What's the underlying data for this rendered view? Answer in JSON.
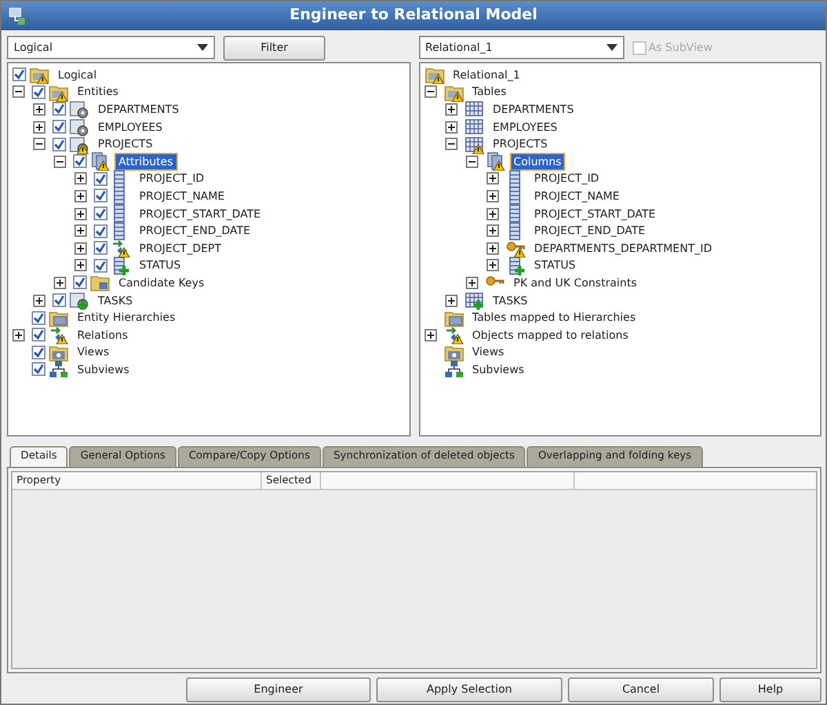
{
  "window": {
    "title": "Engineer to Relational Model"
  },
  "left_panel": {
    "combo": {
      "value": "Logical"
    },
    "filter_button": {
      "label": "Filter"
    },
    "tree": [
      {
        "label": "Logical",
        "kind": "folder",
        "warning": true,
        "checked": true,
        "selected": false,
        "children": [
          {
            "label": "Entities",
            "kind": "folder",
            "warning": true,
            "checked": true,
            "selected": false,
            "expanded": true,
            "children": [
              {
                "label": "DEPARTMENTS",
                "kind": "entity",
                "checked": true,
                "selected": false,
                "expanded": false
              },
              {
                "label": "EMPLOYEES",
                "kind": "entity",
                "checked": true,
                "selected": false,
                "expanded": false
              },
              {
                "label": "PROJECTS",
                "kind": "entity",
                "warning": true,
                "checked": true,
                "selected": false,
                "expanded": true,
                "children": [
                  {
                    "label": "Attributes",
                    "kind": "group",
                    "warning": true,
                    "checked": true,
                    "selected": true,
                    "expanded": true,
                    "children": [
                      {
                        "label": "PROJECT_ID",
                        "kind": "column",
                        "checked": true,
                        "selected": false,
                        "expanded": false
                      },
                      {
                        "label": "PROJECT_NAME",
                        "kind": "column",
                        "checked": true,
                        "selected": false,
                        "expanded": false
                      },
                      {
                        "label": "PROJECT_START_DATE",
                        "kind": "column",
                        "checked": true,
                        "selected": false,
                        "expanded": false
                      },
                      {
                        "label": "PROJECT_END_DATE",
                        "kind": "column",
                        "checked": true,
                        "selected": false,
                        "expanded": false
                      },
                      {
                        "label": "PROJECT_DEPT",
                        "kind": "relation",
                        "warning": true,
                        "checked": true,
                        "selected": false,
                        "expanded": false
                      },
                      {
                        "label": "STATUS",
                        "kind": "column",
                        "added": true,
                        "checked": true,
                        "selected": false,
                        "expanded": false
                      }
                    ]
                  },
                  {
                    "label": "Candidate Keys",
                    "kind": "keyfolder",
                    "checked": true,
                    "selected": false,
                    "expanded": false
                  }
                ]
              },
              {
                "label": "TASKS",
                "kind": "entity",
                "added": true,
                "checked": true,
                "selected": false,
                "expanded": false
              }
            ]
          },
          {
            "label": "Entity Hierarchies",
            "kind": "hierarchy",
            "checked": true,
            "selected": false
          },
          {
            "label": "Relations",
            "kind": "relation",
            "warning": true,
            "checked": true,
            "selected": false,
            "expanded": false
          },
          {
            "label": "Views",
            "kind": "view",
            "checked": true,
            "selected": false
          },
          {
            "label": "Subviews",
            "kind": "subview",
            "checked": true,
            "selected": false
          }
        ]
      }
    ]
  },
  "right_panel": {
    "combo": {
      "value": "Relational_1"
    },
    "subview_checkbox": {
      "label": "As SubView",
      "checked": false,
      "disabled": true
    },
    "tree": [
      {
        "label": "Relational_1",
        "kind": "folder",
        "warning": true,
        "selected": false,
        "children": [
          {
            "label": "Tables",
            "kind": "folder",
            "warning": true,
            "selected": false,
            "expanded": true,
            "children": [
              {
                "label": "DEPARTMENTS",
                "kind": "table",
                "selected": false,
                "expanded": false
              },
              {
                "label": "EMPLOYEES",
                "kind": "table",
                "selected": false,
                "expanded": false
              },
              {
                "label": "PROJECTS",
                "kind": "table",
                "warning": true,
                "selected": false,
                "expanded": true,
                "children": [
                  {
                    "label": "Columns",
                    "kind": "group",
                    "warning": true,
                    "selected": true,
                    "expanded": true,
                    "children": [
                      {
                        "label": "PROJECT_ID",
                        "kind": "column",
                        "selected": false,
                        "expanded": false
                      },
                      {
                        "label": "PROJECT_NAME",
                        "kind": "column",
                        "selected": false,
                        "expanded": false
                      },
                      {
                        "label": "PROJECT_START_DATE",
                        "kind": "column",
                        "selected": false,
                        "expanded": false
                      },
                      {
                        "label": "PROJECT_END_DATE",
                        "kind": "column",
                        "selected": false,
                        "expanded": false
                      },
                      {
                        "label": "DEPARTMENTS_DEPARTMENT_ID",
                        "kind": "key",
                        "warning": true,
                        "selected": false,
                        "expanded": false
                      },
                      {
                        "label": "STATUS",
                        "kind": "column",
                        "added": true,
                        "selected": false,
                        "expanded": false
                      }
                    ]
                  },
                  {
                    "label": "PK and UK Constraints",
                    "kind": "key",
                    "selected": false,
                    "expanded": false
                  }
                ]
              },
              {
                "label": "TASKS",
                "kind": "table",
                "added": true,
                "selected": false,
                "expanded": false
              }
            ]
          },
          {
            "label": "Tables mapped to Hierarchies",
            "kind": "hierarchy",
            "selected": false
          },
          {
            "label": "Objects mapped to relations",
            "kind": "relation",
            "warning": true,
            "selected": false,
            "expanded": false
          },
          {
            "label": "Views",
            "kind": "view",
            "selected": false
          },
          {
            "label": "Subviews",
            "kind": "subview",
            "selected": false
          }
        ]
      }
    ]
  },
  "tabs": [
    {
      "label": "Details",
      "selected": true
    },
    {
      "label": "General Options",
      "selected": false
    },
    {
      "label": "Compare/Copy Options",
      "selected": false
    },
    {
      "label": "Synchronization of deleted objects",
      "selected": false
    },
    {
      "label": "Overlapping and folding keys",
      "selected": false
    }
  ],
  "table": {
    "columns": [
      "Property",
      "Selected"
    ]
  },
  "buttons": [
    {
      "label": "Engineer"
    },
    {
      "label": "Apply Selection"
    },
    {
      "label": "Cancel"
    },
    {
      "label": "Help"
    }
  ]
}
